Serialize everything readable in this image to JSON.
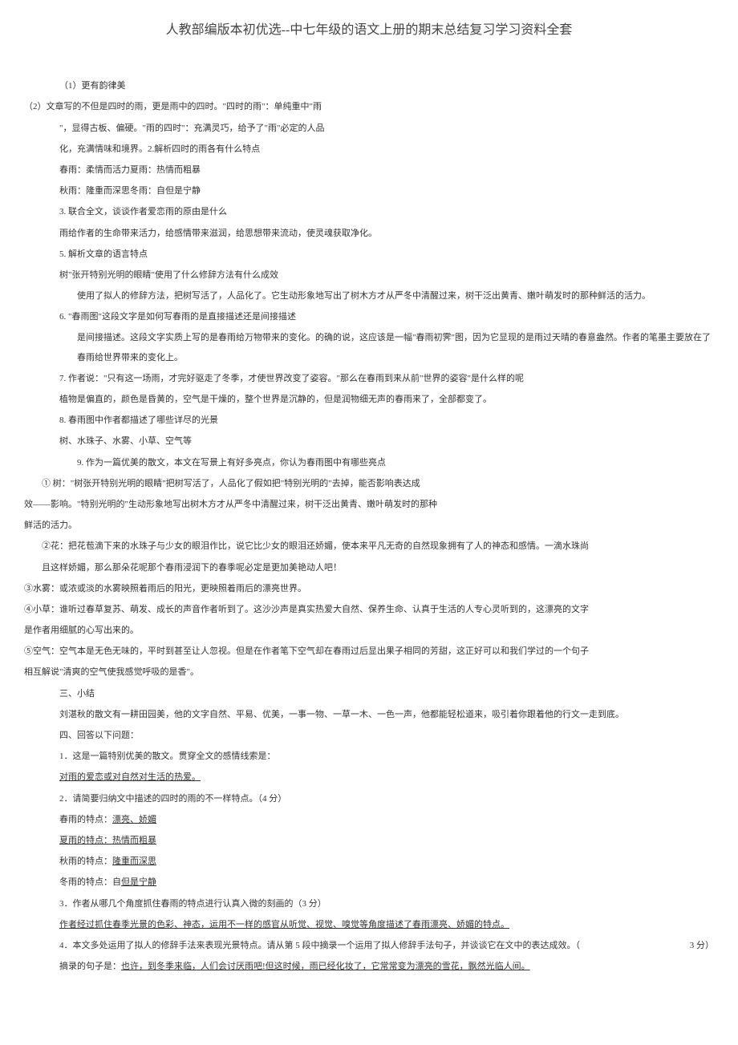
{
  "title": "人教部编版本初优选--中七年级的语文上册的期末总结复习学习资料全套",
  "lines": {
    "l1": "（1）更有韵律美",
    "l2": "（2）文章写的不但是四时的雨，更是雨中的四时。\"四时的雨\"：单纯重中\"雨",
    "l3": "\"，显得古板、偏硬。\"雨的四时\"：充满灵巧，给予了\"雨\"必定的人品",
    "l4": "化，充满情味和境界。2.解析四时的雨各有什么特点",
    "l5": "春雨：柔情而活力夏雨：热情而粗暴",
    "l6": "秋雨：隆重而深思冬雨：自但是宁静",
    "l7": "3. 联合全文，谈谈作者爱恋雨的原由是什么",
    "l8": "雨给作者的生命带来活力，给感情带来滋润，给思想带来流动，使灵魂获取净化。",
    "l9": "5. 解析文章的语言特点",
    "l10": "树\"张开特别光明的眼睛\"使用了什么修辞方法有什么成效",
    "l11": "使用了拟人的修辞方法，把树写活了，人品化了。它生动形象地写出了树木方才从严冬中清醒过来，树干泛出黄青、嫩叶萌发时的那种鲜活的活力。",
    "l12": "6. \"春雨图\"这段文字是如何写春雨的是直接描述还是间接描述",
    "l13": "是间接描述。这段文字实质上写的是春雨给万物带来的变化。的确的说，这应该是一幅\"春雨初霁\"图，因为它显现的是雨过天晴的春意盎然。作者的笔墨主要放在了春雨给世界带来的变化上。",
    "l14": "7. 作者说：\"只有这一场雨，才完好驱走了冬季，才使世界改变了姿容。\"那么在春雨到来从前\"世界的姿容\"是什么样的呢",
    "l15": "植物是偏直的，颜色是昏黄的，空气是干燥的，整个世界是沉静的，但是润物细无声的春雨来了，全部都变了。",
    "l16": "8. 春雨图中作者都描述了哪些详尽的光景",
    "l17": "树、水珠子、水雾、小草、空气等",
    "l18": "9. 作为一篇优美的散文，本文在写景上有好多亮点，你认为春雨图中有哪些亮点",
    "l19": "① 树：\"树张开特别光明的眼睛\"把树写活了，人品化了假如把\"特别光明的\"去掉，能否影响表达成",
    "l20": "效——影响。\"特别光明的\"生动形象地写出树木方才从严冬中清醒过来，树干泛出黄青、嫩叶萌发时的那种",
    "l21": "鲜活的活力。",
    "l22": "②花：把花苞滴下来的水珠子与少女的眼泪作比，说它比少女的眼泪还娇媚，使本来平凡无奇的自然现象拥有了人的神态和感情。一滴水珠尚",
    "l23": "且这样娇媚，那么那朵花呢那个春雨浸润下的春季呢必定是更加美艳动人吧！",
    "l24": "③水雾：或浓或淡的水雾映照着雨后的阳光，更映照着雨后的漂亮世界。",
    "l25": "④小草：谁听过春草复苏、萌发、成长的声音作者听到了。这沙沙声是真实热爱大自然、保养生命、认真于生活的人专心灵听到的，这漂亮的文字",
    "l26": "是作者用细腻的心写出来的。",
    "l27": "⑤空气：空气本是无色无味的，平时到甚至让人忽视。但是在作者笔下空气却在春雨过后显出果子相同的芳甜，这正好可以和我们学过的一个句子",
    "l28": "相互解说\"清爽的空气使我感觉呼吸的是香\"。",
    "l29": "三、小结",
    "l30": "刘湛秋的散文有一耕田园美，他的文字自然、平易、优美，一事一物、一草一木、一色一声，他都能轻松道来，吸引着你跟着他的行文一走到底。",
    "l31": "四、回答以下问题：",
    "l32": "1．这是一篇特别优美的散文。贯穿全文的感情线索是：",
    "l33": "对雨的爱恋或对自然对生活的热爱。",
    "l34": "2．请简要归纳文中描述的四时的雨的不一样特点。（4 分）",
    "l35": "春雨的特点：",
    "l35v": "漂亮、娇媚",
    "l36": "夏雨的特点：",
    "l36v": "热情而粗暴",
    "l37": "秋雨的特点：",
    "l37v": "隆重而深思",
    "l38": "冬雨的特点：自",
    "l38v": "但是宁静",
    "l39": "3．作者从哪几个角度抓住春雨的特点进行认真入微的刻画的（3 分）",
    "l40": "作者经过抓住春季光景的色彩、神态，运用不一样的感官从听觉、视觉、嗅觉等角度描述了春雨漂亮、娇媚的特点。",
    "l41": "4．本文多处运用了拟人的修辞手法来表现光景特点。请从第 5 段中摘录一个运用了拟人修辞手法句子，并谈谈它在文中的表达成效。（",
    "l41s": "3 分）",
    "l42": "摘录的句子是：",
    "l42v": "也许，到冬季来临，人们会讨厌雨吧!但这时候，雨已经化妆了，它常常变为漂亮的雪花，飘然光临人间。"
  }
}
